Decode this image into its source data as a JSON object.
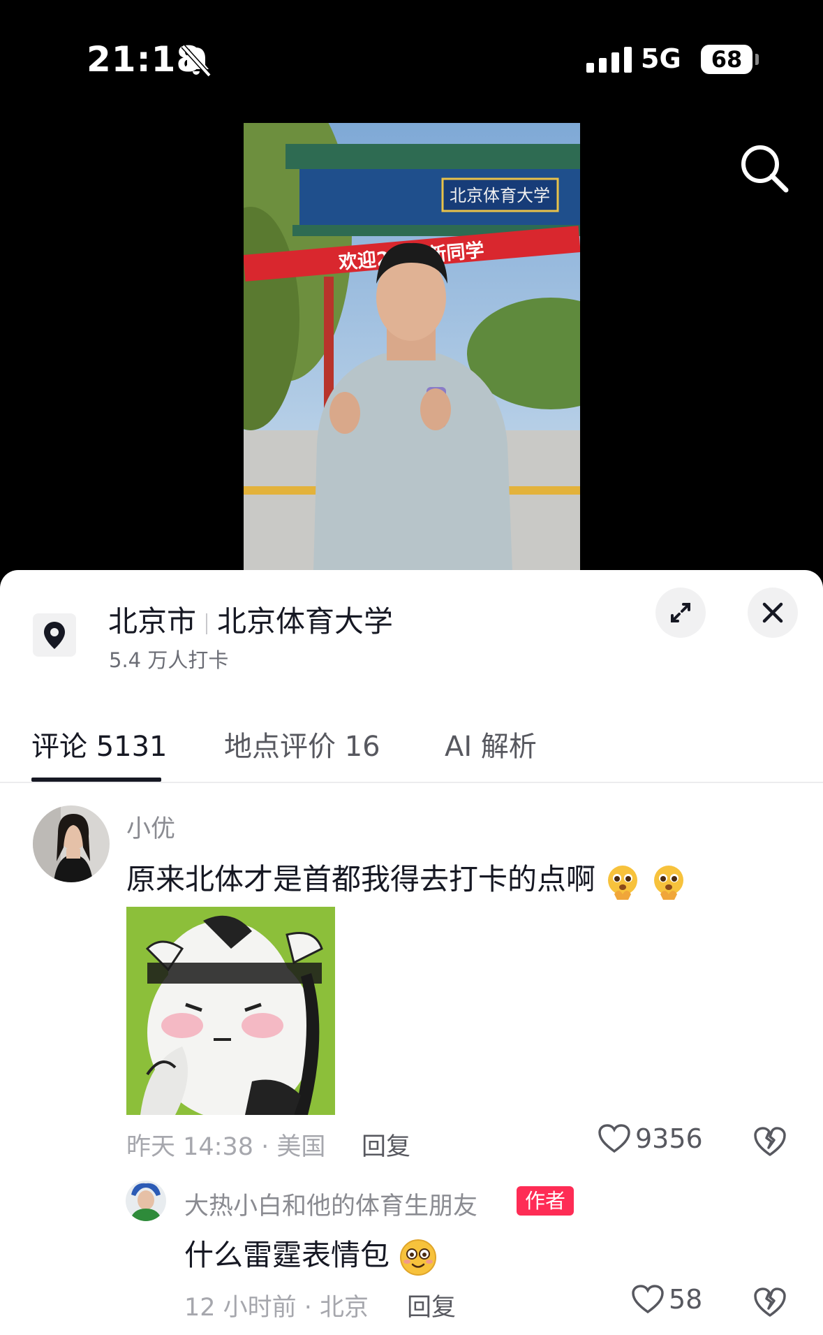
{
  "status_bar": {
    "time": "21:18",
    "network": "5G",
    "battery": "68",
    "icons": [
      "bell-off-icon",
      "signal-icon",
      "battery-icon"
    ]
  },
  "video": {
    "banner_text": "欢迎2 6级新同学",
    "gate_sign": "北京体育大学"
  },
  "location": {
    "city": "北京市",
    "place": "北京体育大学",
    "checkins": "5.4 万人打卡"
  },
  "tabs": [
    {
      "label": "评论 5131",
      "active": true
    },
    {
      "label": "地点评价 16",
      "active": false
    },
    {
      "label": "AI 解析",
      "active": false
    }
  ],
  "comments": [
    {
      "username": "小优",
      "text": "原来北体才是首都我得去打卡的点啊",
      "emoji": "pleading-hands-emoji",
      "has_sticker": true,
      "time": "昨天 14:38 · 美国",
      "reply_label": "回复",
      "likes": "9356"
    },
    {
      "username": "大热小白和他的体育生朋友",
      "badge": "作者",
      "text": "什么雷霆表情包",
      "emoji": "flushed-smile-emoji",
      "time": "12 小时前 · 北京",
      "reply_label": "回复",
      "likes": "58"
    }
  ],
  "colors": {
    "accent": "#fe2c55",
    "text_primary": "#161823",
    "text_secondary": "#8a8b91",
    "sticker_bg": "#8cbf3a"
  }
}
